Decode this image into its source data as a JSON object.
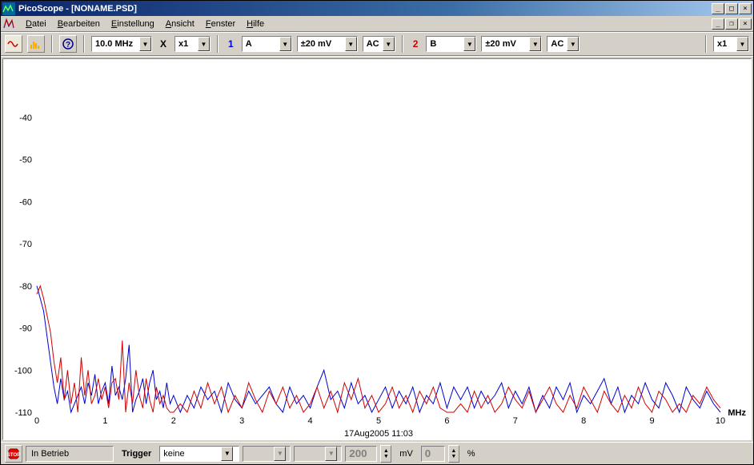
{
  "title": "PicoScope - [NONAME.PSD]",
  "menus": [
    "Datei",
    "Bearbeiten",
    "Einstellung",
    "Ansicht",
    "Fenster",
    "Hilfe"
  ],
  "toolbar": {
    "timebase": "10.0 MHz",
    "x_label": "X",
    "x_zoom": "x1",
    "ch1": {
      "num": "1",
      "src": "A",
      "range": "±20 mV",
      "coupling": "AC"
    },
    "ch2": {
      "num": "2",
      "src": "B",
      "range": "±20 mV",
      "coupling": "AC"
    },
    "y_zoom": "x1"
  },
  "status": {
    "run": "In Betrieb",
    "trigger_label": "Trigger",
    "trigger_mode": "keine",
    "level": "200",
    "level_unit": "mV",
    "pct": "0",
    "pct_unit": "%"
  },
  "chart_data": {
    "type": "line",
    "xlabel": "MHz",
    "ylabel": "",
    "title": "",
    "timestamp": "17Aug2005  11:03",
    "xlim": [
      0,
      10
    ],
    "ylim": [
      -110,
      -30
    ],
    "yticks": [
      -40,
      -50,
      -60,
      -70,
      -80,
      -90,
      -100,
      -110
    ],
    "xticks": [
      0,
      1,
      2,
      3,
      4,
      5,
      6,
      7,
      8,
      9,
      10
    ],
    "series": [
      {
        "name": "A (Ch1)",
        "color": "#0000d0",
        "x": [
          0.0,
          0.05,
          0.1,
          0.15,
          0.2,
          0.25,
          0.3,
          0.35,
          0.4,
          0.45,
          0.5,
          0.55,
          0.6,
          0.65,
          0.7,
          0.75,
          0.8,
          0.85,
          0.9,
          0.95,
          1.0,
          1.05,
          1.1,
          1.15,
          1.2,
          1.25,
          1.3,
          1.35,
          1.4,
          1.45,
          1.5,
          1.55,
          1.6,
          1.65,
          1.7,
          1.75,
          1.8,
          1.85,
          1.9,
          1.95,
          2.0,
          2.1,
          2.2,
          2.3,
          2.4,
          2.5,
          2.6,
          2.7,
          2.8,
          2.9,
          3.0,
          3.1,
          3.2,
          3.3,
          3.4,
          3.5,
          3.6,
          3.7,
          3.8,
          3.9,
          4.0,
          4.1,
          4.2,
          4.3,
          4.4,
          4.5,
          4.6,
          4.7,
          4.8,
          4.9,
          5.0,
          5.1,
          5.2,
          5.3,
          5.4,
          5.5,
          5.6,
          5.7,
          5.8,
          5.9,
          6.0,
          6.1,
          6.2,
          6.3,
          6.4,
          6.5,
          6.6,
          6.7,
          6.8,
          6.9,
          7.0,
          7.1,
          7.2,
          7.3,
          7.4,
          7.5,
          7.6,
          7.7,
          7.8,
          7.9,
          8.0,
          8.1,
          8.2,
          8.3,
          8.4,
          8.5,
          8.6,
          8.7,
          8.8,
          8.9,
          9.0,
          9.1,
          9.2,
          9.3,
          9.4,
          9.5,
          9.6,
          9.7,
          9.8,
          9.9,
          10.0
        ],
        "y": [
          -80,
          -83,
          -86,
          -92,
          -98,
          -104,
          -108,
          -102,
          -107,
          -105,
          -110,
          -108,
          -106,
          -104,
          -108,
          -103,
          -106,
          -101,
          -108,
          -105,
          -103,
          -108,
          -99,
          -106,
          -104,
          -107,
          -102,
          -94,
          -110,
          -107,
          -105,
          -102,
          -108,
          -103,
          -100,
          -107,
          -105,
          -109,
          -103,
          -108,
          -106,
          -110,
          -106,
          -109,
          -104,
          -107,
          -105,
          -110,
          -103,
          -107,
          -109,
          -105,
          -108,
          -106,
          -104,
          -108,
          -110,
          -104,
          -108,
          -106,
          -109,
          -104,
          -100,
          -107,
          -105,
          -109,
          -103,
          -108,
          -106,
          -110,
          -107,
          -104,
          -109,
          -105,
          -108,
          -104,
          -110,
          -106,
          -108,
          -103,
          -109,
          -104,
          -107,
          -104,
          -109,
          -105,
          -108,
          -106,
          -103,
          -109,
          -105,
          -108,
          -104,
          -110,
          -106,
          -109,
          -104,
          -107,
          -103,
          -110,
          -106,
          -108,
          -105,
          -102,
          -108,
          -104,
          -110,
          -106,
          -108,
          -103,
          -107,
          -109,
          -103,
          -106,
          -110,
          -104,
          -107,
          -109,
          -105,
          -108,
          -110
        ]
      },
      {
        "name": "B (Ch2)",
        "color": "#d00000",
        "x": [
          0.0,
          0.05,
          0.1,
          0.15,
          0.2,
          0.25,
          0.3,
          0.35,
          0.4,
          0.45,
          0.5,
          0.55,
          0.6,
          0.65,
          0.7,
          0.75,
          0.8,
          0.85,
          0.9,
          0.95,
          1.0,
          1.05,
          1.1,
          1.15,
          1.2,
          1.25,
          1.3,
          1.35,
          1.4,
          1.45,
          1.5,
          1.55,
          1.6,
          1.65,
          1.7,
          1.75,
          1.8,
          1.85,
          1.9,
          1.95,
          2.0,
          2.1,
          2.2,
          2.3,
          2.4,
          2.5,
          2.6,
          2.7,
          2.8,
          2.9,
          3.0,
          3.1,
          3.2,
          3.3,
          3.4,
          3.5,
          3.6,
          3.7,
          3.8,
          3.9,
          4.0,
          4.1,
          4.2,
          4.3,
          4.4,
          4.5,
          4.6,
          4.7,
          4.8,
          4.9,
          5.0,
          5.1,
          5.2,
          5.3,
          5.4,
          5.5,
          5.6,
          5.7,
          5.8,
          5.9,
          6.0,
          6.1,
          6.2,
          6.3,
          6.4,
          6.5,
          6.6,
          6.7,
          6.8,
          6.9,
          7.0,
          7.1,
          7.2,
          7.3,
          7.4,
          7.5,
          7.6,
          7.7,
          7.8,
          7.9,
          8.0,
          8.1,
          8.2,
          8.3,
          8.4,
          8.5,
          8.6,
          8.7,
          8.8,
          8.9,
          9.0,
          9.1,
          9.2,
          9.3,
          9.4,
          9.5,
          9.6,
          9.7,
          9.8,
          9.9,
          10.0
        ],
        "y": [
          -82,
          -80,
          -83,
          -87,
          -91,
          -98,
          -103,
          -97,
          -107,
          -100,
          -108,
          -103,
          -110,
          -97,
          -106,
          -100,
          -108,
          -106,
          -102,
          -107,
          -104,
          -109,
          -103,
          -102,
          -107,
          -93,
          -110,
          -103,
          -108,
          -100,
          -106,
          -109,
          -102,
          -107,
          -110,
          -104,
          -108,
          -106,
          -109,
          -110,
          -110,
          -108,
          -110,
          -105,
          -109,
          -103,
          -108,
          -104,
          -110,
          -106,
          -109,
          -103,
          -107,
          -110,
          -105,
          -108,
          -104,
          -109,
          -106,
          -110,
          -108,
          -104,
          -109,
          -105,
          -110,
          -103,
          -107,
          -102,
          -109,
          -106,
          -110,
          -108,
          -104,
          -109,
          -106,
          -110,
          -105,
          -108,
          -104,
          -109,
          -110,
          -110,
          -108,
          -110,
          -105,
          -109,
          -106,
          -110,
          -108,
          -104,
          -107,
          -109,
          -105,
          -110,
          -107,
          -104,
          -108,
          -110,
          -106,
          -109,
          -104,
          -107,
          -110,
          -105,
          -108,
          -110,
          -106,
          -109,
          -104,
          -108,
          -110,
          -105,
          -107,
          -110,
          -108,
          -110,
          -106,
          -108,
          -104,
          -107,
          -109
        ]
      }
    ]
  }
}
